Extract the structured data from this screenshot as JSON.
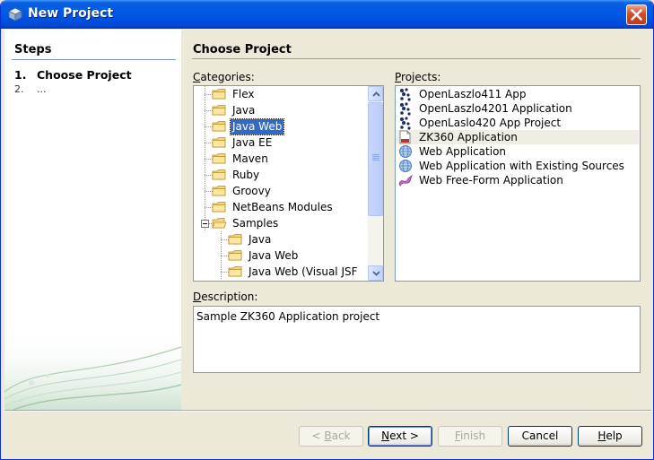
{
  "window": {
    "title": "New Project"
  },
  "steps": {
    "header": "Steps",
    "items": [
      {
        "num": "1.",
        "label": "Choose Project"
      },
      {
        "num": "2.",
        "label": "..."
      }
    ]
  },
  "main": {
    "header": "Choose Project",
    "categories_label_u": "C",
    "categories_label_rest": "ategories:",
    "projects_label_u": "P",
    "projects_label_rest": "rojects:",
    "description_label_u": "D",
    "description_label_rest": "escription:",
    "categories": [
      {
        "label": "Flex"
      },
      {
        "label": "Java"
      },
      {
        "label": "Java Web",
        "selected": true
      },
      {
        "label": "Java EE"
      },
      {
        "label": "Maven"
      },
      {
        "label": "Ruby"
      },
      {
        "label": "Groovy"
      },
      {
        "label": "NetBeans Modules"
      },
      {
        "label": "Samples",
        "expanded": true
      },
      {
        "label": "Java",
        "child": true
      },
      {
        "label": "Java Web",
        "child": true
      },
      {
        "label": "Java Web (Visual JSF",
        "child": true
      }
    ],
    "projects": [
      {
        "label": "OpenLaszlo411 App",
        "icon": "openlaszlo-icon"
      },
      {
        "label": "OpenLaszlo4201 Application",
        "icon": "openlaszlo-icon"
      },
      {
        "label": "OpenLaslo420 App Project",
        "icon": "openlaszlo-icon"
      },
      {
        "label": "ZK360 Application",
        "icon": "zk-document-icon",
        "selected": true
      },
      {
        "label": "Web Application",
        "icon": "globe-icon"
      },
      {
        "label": "Web Application with Existing Sources",
        "icon": "globe-icon"
      },
      {
        "label": "Web Free-Form Application",
        "icon": "freeform-icon"
      }
    ],
    "description": "Sample ZK360 Application project"
  },
  "buttons": {
    "back_u": "B",
    "back_pre": "< ",
    "back_rest": "ack",
    "next_u": "N",
    "next_rest": "ext >",
    "finish_u": "F",
    "finish_rest": "inish",
    "cancel": "Cancel",
    "help_u": "H",
    "help_rest": "elp"
  },
  "colors": {
    "selection": "#316ac5",
    "titlebar": "#0058e6",
    "border": "#7f9db9"
  }
}
